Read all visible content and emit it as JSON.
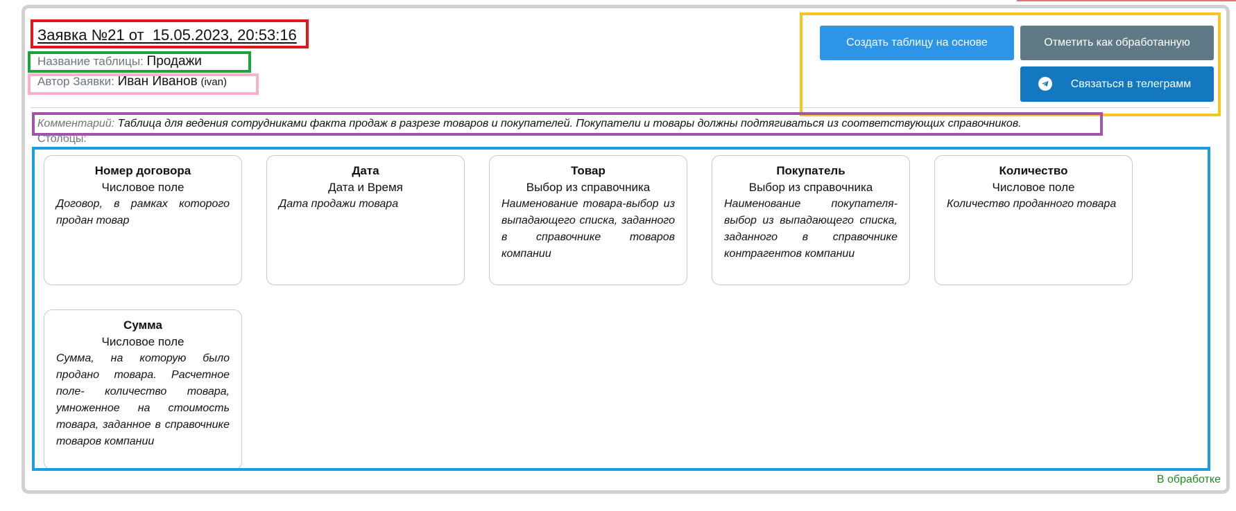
{
  "request": {
    "title": "Заявка №21 от  15.05.2023, 20:53:16",
    "table_name_label": "Название таблицы:",
    "table_name_value": "Продажи",
    "author_label": "Автор Заявки:",
    "author_name": "Иван Иванов",
    "author_login": "(ivan)",
    "comment_label": "Комментарий:",
    "comment_text": "Таблица для ведения сотрудниками факта продаж в разрезе товаров и покупателей. Покупатели и товары должны подтягиваться из соответствующих справочников.",
    "columns_label": "Столбцы:",
    "status": "В обработке"
  },
  "actions": {
    "create_label": "Создать таблицу на основе",
    "mark_label": "Отметить как обработанную",
    "telegram_label": "Связаться в телеграмм"
  },
  "columns": [
    {
      "name": "Номер договора",
      "type": "Числовое поле",
      "description": "Договор, в рамках которого продан товар"
    },
    {
      "name": "Дата",
      "type": "Дата и Время",
      "description": "Дата продажи товара"
    },
    {
      "name": "Товар",
      "type": "Выбор из справочника",
      "description": "Наименование товара-выбор из выпадающего списка, заданного в справочнике товаров компании"
    },
    {
      "name": "Покупатель",
      "type": "Выбор из справочника",
      "description": "Наименование покупателя-выбор из выпадающего списка, заданного в справочнике контрагентов компании"
    },
    {
      "name": "Количество",
      "type": "Числовое поле",
      "description": "Количество проданного товара"
    },
    {
      "name": "Сумма",
      "type": "Числовое поле",
      "description": "Сумма, на которую было продано товара. Расчетное поле- количество товара, умноженное на стоимость товара, заданное в справочнике товаров компании"
    }
  ],
  "colors": {
    "highlight_title": "#e0191f",
    "highlight_table_name": "#1da33b",
    "highlight_author": "#f8b0cc",
    "highlight_actions": "#f8c41f",
    "highlight_comment": "#a253aa",
    "highlight_columns": "#1b9ee0",
    "button_create": "#2d95e8",
    "button_mark": "#5f7a84",
    "button_telegram": "#1478c0",
    "status": "#1e8a1e"
  },
  "icons": {
    "telegram": "telegram-icon"
  }
}
